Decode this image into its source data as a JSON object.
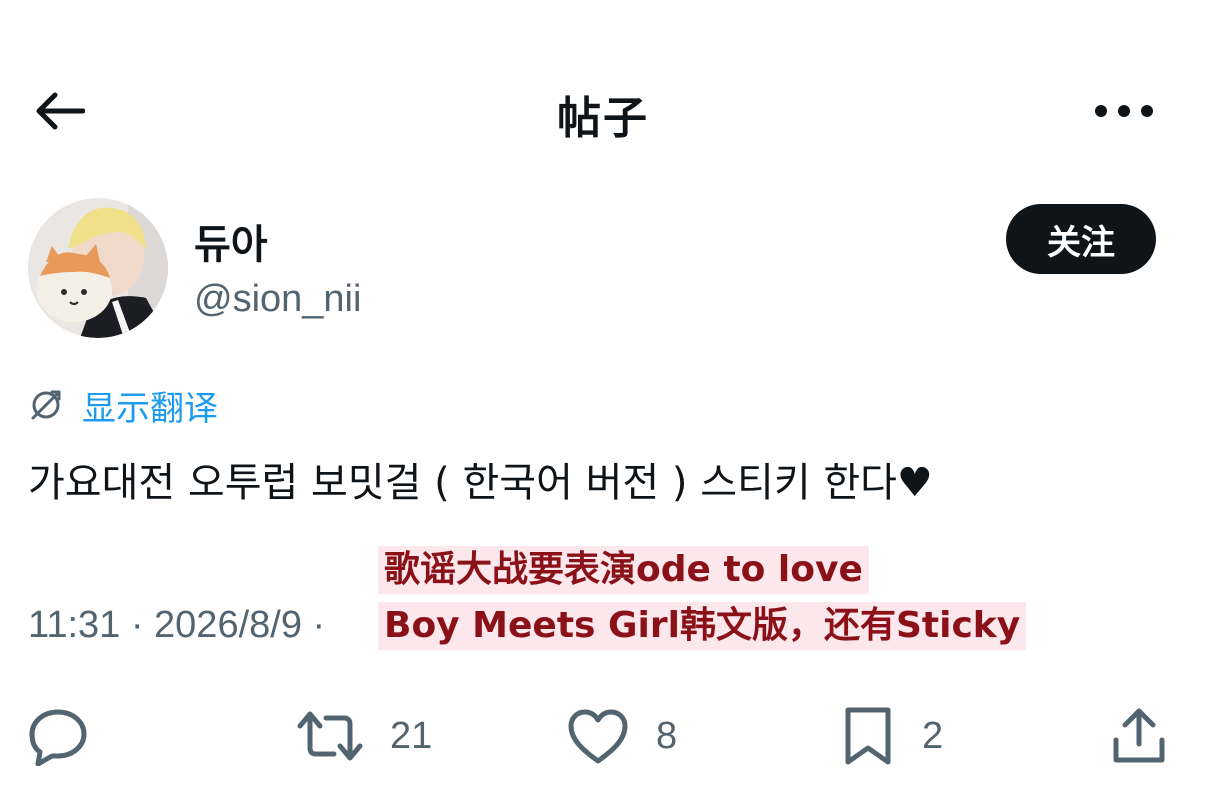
{
  "header": {
    "title": "帖子",
    "back_icon": "arrow-left-icon",
    "more_icon": "more-horizontal-icon"
  },
  "author": {
    "display_name": "듀아",
    "handle": "@sion_nii",
    "follow_label": "关注"
  },
  "translate": {
    "label": "显示翻译",
    "icon": "globe-icon",
    "color": "#1d9bf0"
  },
  "post": {
    "text": "가요대전 오투럽 보밋걸 ( 한국어 버전 ) 스티키 한다♥",
    "timestamp": "11:31 · 2026/8/9 ·"
  },
  "caption": {
    "line1": "歌谣大战要表演ode to love",
    "line2": "Boy Meets Girl韩文版，还有Sticky",
    "text_color": "#8b1118",
    "bg_color": "#fbe7ec"
  },
  "actions": {
    "reply": {
      "icon": "reply-icon",
      "count": ""
    },
    "retweet": {
      "icon": "retweet-icon",
      "count": "21"
    },
    "like": {
      "icon": "heart-icon",
      "count": "8"
    },
    "bookmark": {
      "icon": "bookmark-icon",
      "count": "2"
    },
    "share": {
      "icon": "share-icon"
    }
  },
  "colors": {
    "text": "#0f1419",
    "secondary": "#536471",
    "follow_bg": "#0f1419"
  }
}
